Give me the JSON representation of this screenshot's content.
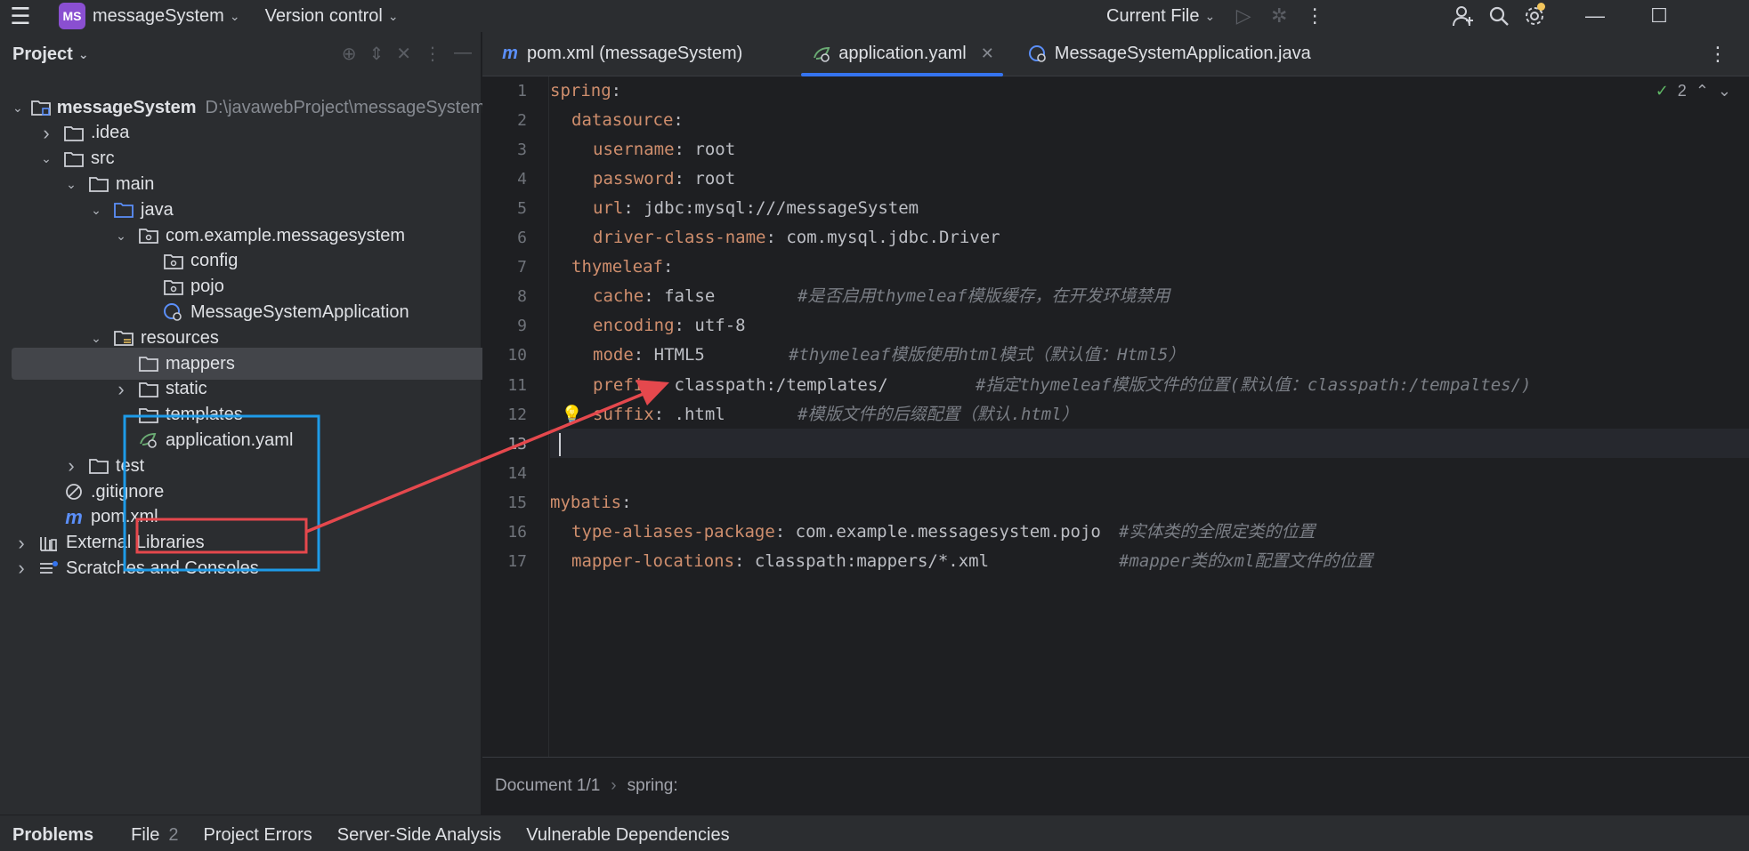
{
  "titlebar": {
    "project_badge": "MS",
    "project_name": "messageSystem",
    "vcs": "Version control",
    "run_config": "Current File"
  },
  "project_panel": {
    "title": "Project",
    "tree": [
      {
        "label": "messageSystem",
        "hint": "D:\\javawebProject\\messageSystem",
        "icon": "folder-module-icon",
        "arrow": "open"
      },
      {
        "label": ".idea",
        "icon": "folder-icon",
        "arrow": "closed"
      },
      {
        "label": "src",
        "icon": "folder-icon",
        "arrow": "open"
      },
      {
        "label": "main",
        "icon": "folder-icon",
        "arrow": "open"
      },
      {
        "label": "java",
        "icon": "source-folder-icon",
        "arrow": "open"
      },
      {
        "label": "com.example.messagesystem",
        "icon": "package-icon",
        "arrow": "open"
      },
      {
        "label": "config",
        "icon": "package-icon",
        "arrow": "none"
      },
      {
        "label": "pojo",
        "icon": "package-icon",
        "arrow": "none"
      },
      {
        "label": "MessageSystemApplication",
        "icon": "spring-class-icon",
        "arrow": "none"
      },
      {
        "label": "resources",
        "icon": "resources-folder-icon",
        "arrow": "open"
      },
      {
        "label": "mappers",
        "icon": "folder-icon",
        "arrow": "none"
      },
      {
        "label": "static",
        "icon": "folder-icon",
        "arrow": "closed"
      },
      {
        "label": "templates",
        "icon": "folder-icon",
        "arrow": "none"
      },
      {
        "label": "application.yaml",
        "icon": "yaml-config-icon",
        "arrow": "none"
      },
      {
        "label": "test",
        "icon": "folder-icon",
        "arrow": "closed"
      },
      {
        "label": ".gitignore",
        "icon": "ignored-file-icon",
        "arrow": "none"
      },
      {
        "label": "pom.xml",
        "icon": "maven-icon",
        "arrow": "none"
      },
      {
        "label": "External Libraries",
        "icon": "library-icon",
        "arrow": "closed"
      },
      {
        "label": "Scratches and Consoles",
        "icon": "scratches-icon",
        "arrow": "closed"
      }
    ]
  },
  "editor": {
    "tabs": [
      {
        "label": "pom.xml (messageSystem)",
        "icon": "maven-icon"
      },
      {
        "label": "application.yaml",
        "icon": "yaml-config-icon"
      },
      {
        "label": "MessageSystemApplication.java",
        "icon": "spring-class-icon"
      }
    ],
    "active_tab": 1,
    "inspection_count": "2",
    "lines": [
      {
        "n": "1",
        "key": "spring",
        "sep": ":",
        "val": "",
        "comment": ""
      },
      {
        "n": "2",
        "key": "datasource",
        "sep": ":",
        "val": "",
        "comment": ""
      },
      {
        "n": "3",
        "key": "username",
        "sep": ":",
        "val": " root",
        "comment": ""
      },
      {
        "n": "4",
        "key": "password",
        "sep": ":",
        "val": " root",
        "comment": ""
      },
      {
        "n": "5",
        "key": "url",
        "sep": ":",
        "val": " jdbc:mysql:///messageSystem",
        "comment": ""
      },
      {
        "n": "6",
        "key": "driver-class-name",
        "sep": ":",
        "val": " com.mysql.jdbc.Driver",
        "comment": ""
      },
      {
        "n": "7",
        "key": "thymeleaf",
        "sep": ":",
        "val": "",
        "comment": ""
      },
      {
        "n": "8",
        "key": "cache",
        "sep": ":",
        "val": " false",
        "comment": "#是否启用thymeleaf模版缓存，在开发环境禁用"
      },
      {
        "n": "9",
        "key": "encoding",
        "sep": ":",
        "val": " utf-8",
        "comment": ""
      },
      {
        "n": "10",
        "key": "mode",
        "sep": ":",
        "val": " HTML5",
        "comment": "#thymeleaf模版使用html模式（默认值：Html5）"
      },
      {
        "n": "11",
        "key": "prefix",
        "sep": ":",
        "val": " classpath:/templates/",
        "comment": "#指定thymeleaf模版文件的位置(默认值：classpath:/tempaltes/)"
      },
      {
        "n": "12",
        "key": "suffix",
        "sep": ":",
        "val": " .html",
        "comment": "#模版文件的后缀配置（默认.html）"
      },
      {
        "n": "13",
        "key": "",
        "sep": "",
        "val": "",
        "comment": ""
      },
      {
        "n": "14",
        "key": "",
        "sep": "",
        "val": "",
        "comment": ""
      },
      {
        "n": "15",
        "key": "mybatis",
        "sep": ":",
        "val": "",
        "comment": ""
      },
      {
        "n": "16",
        "key": "type-aliases-package",
        "sep": ":",
        "val": " com.example.messagesystem.pojo",
        "comment": "#实体类的全限定类的位置"
      },
      {
        "n": "17",
        "key": "mapper-locations",
        "sep": ":",
        "val": " classpath:mappers/*.xml",
        "comment": "#mapper类的xml配置文件的位置"
      }
    ],
    "breadcrumbs": {
      "doc": "Document 1/1",
      "sep": "›",
      "path": "spring:"
    }
  },
  "bottom_tabs": [
    {
      "label": "Problems",
      "count": ""
    },
    {
      "label": "File",
      "count": "2"
    },
    {
      "label": "Project Errors",
      "count": ""
    },
    {
      "label": "Server-Side Analysis",
      "count": ""
    },
    {
      "label": "Vulnerable Dependencies",
      "count": ""
    }
  ],
  "colors": {
    "accent": "#3574f0",
    "annotation_blue": "#1e9be8",
    "annotation_red": "#e5484d",
    "yaml_key": "#cf8e6d",
    "comment": "#7a7e85"
  }
}
